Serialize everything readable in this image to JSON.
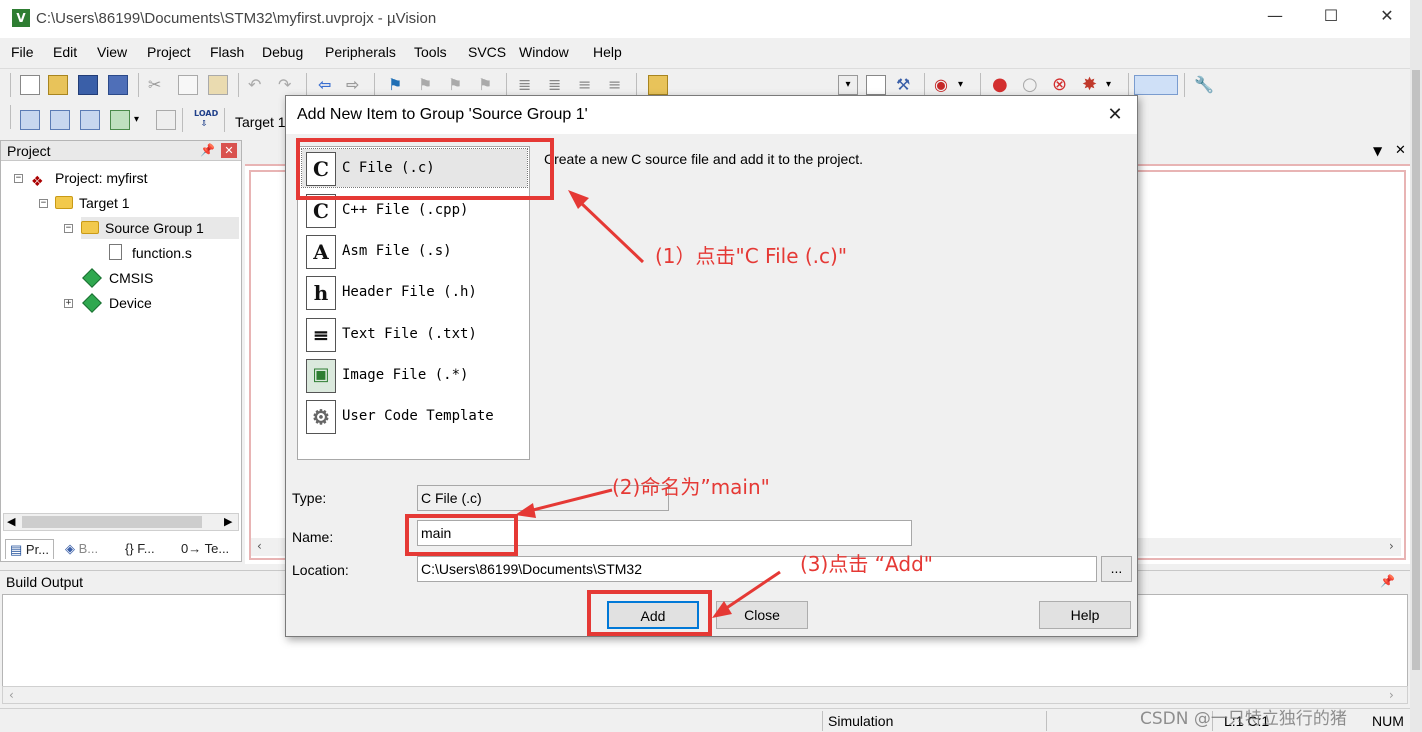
{
  "window": {
    "title": "C:\\Users\\86199\\Documents\\STM32\\myfirst.uvprojx - µVision",
    "app_icon": "V",
    "controls": {
      "minimize": "—",
      "maximize": "☐",
      "close": "✕"
    }
  },
  "menu": [
    "File",
    "Edit",
    "View",
    "Project",
    "Flash",
    "Debug",
    "Peripherals",
    "Tools",
    "SVCS",
    "Window",
    "Help"
  ],
  "toolbar2": {
    "target_label": "Target 1"
  },
  "project_panel": {
    "title": "Project",
    "tree": {
      "project": "Project: myfirst",
      "target": "Target 1",
      "group": "Source Group 1",
      "file": "function.s",
      "cmsis": "CMSIS",
      "device": "Device"
    },
    "tabs": [
      "Pr...",
      "B...",
      "{} F...",
      "0→ Te..."
    ]
  },
  "build_output": {
    "title": "Build Output"
  },
  "statusbar": {
    "mode": "Simulation",
    "position": "L:1 C:1",
    "num": "NUM"
  },
  "dialog": {
    "title": "Add New Item to Group 'Source Group 1'",
    "close_glyph": "✕",
    "templates": [
      {
        "glyph": "C",
        "label": "C File (.c)",
        "icon": "c-file-icon"
      },
      {
        "glyph": "C",
        "label": "C++ File (.cpp)",
        "icon": "cpp-file-icon"
      },
      {
        "glyph": "A",
        "label": "Asm File (.s)",
        "icon": "asm-file-icon"
      },
      {
        "glyph": "h",
        "label": "Header File (.h)",
        "icon": "header-file-icon"
      },
      {
        "glyph": "≡",
        "label": "Text File (.txt)",
        "icon": "text-file-icon"
      },
      {
        "glyph": "▣",
        "label": "Image File (.*)",
        "icon": "image-file-icon"
      },
      {
        "glyph": "⚙",
        "label": "User Code Template",
        "icon": "template-icon"
      }
    ],
    "description": "Create a new C source file and add it to the project.",
    "type_label": "Type:",
    "type_value": "C File (.c)",
    "name_label": "Name:",
    "name_value": "main",
    "location_label": "Location:",
    "location_value": "C:\\Users\\86199\\Documents\\STM32",
    "browse_label": "...",
    "buttons": {
      "add": "Add",
      "close": "Close",
      "help": "Help"
    }
  },
  "annotations": {
    "step1": "(1）点击\"C File (.c)\"",
    "step2": "(2)命名为”main\"",
    "step3": "(3)点击 “Add\"",
    "color": "#e53935"
  },
  "watermark": "CSDN @一只特立独行的猪",
  "colors": {
    "highlight": "#e53935",
    "editor_border": "#e8b4b4",
    "focus": "#0078d7"
  }
}
